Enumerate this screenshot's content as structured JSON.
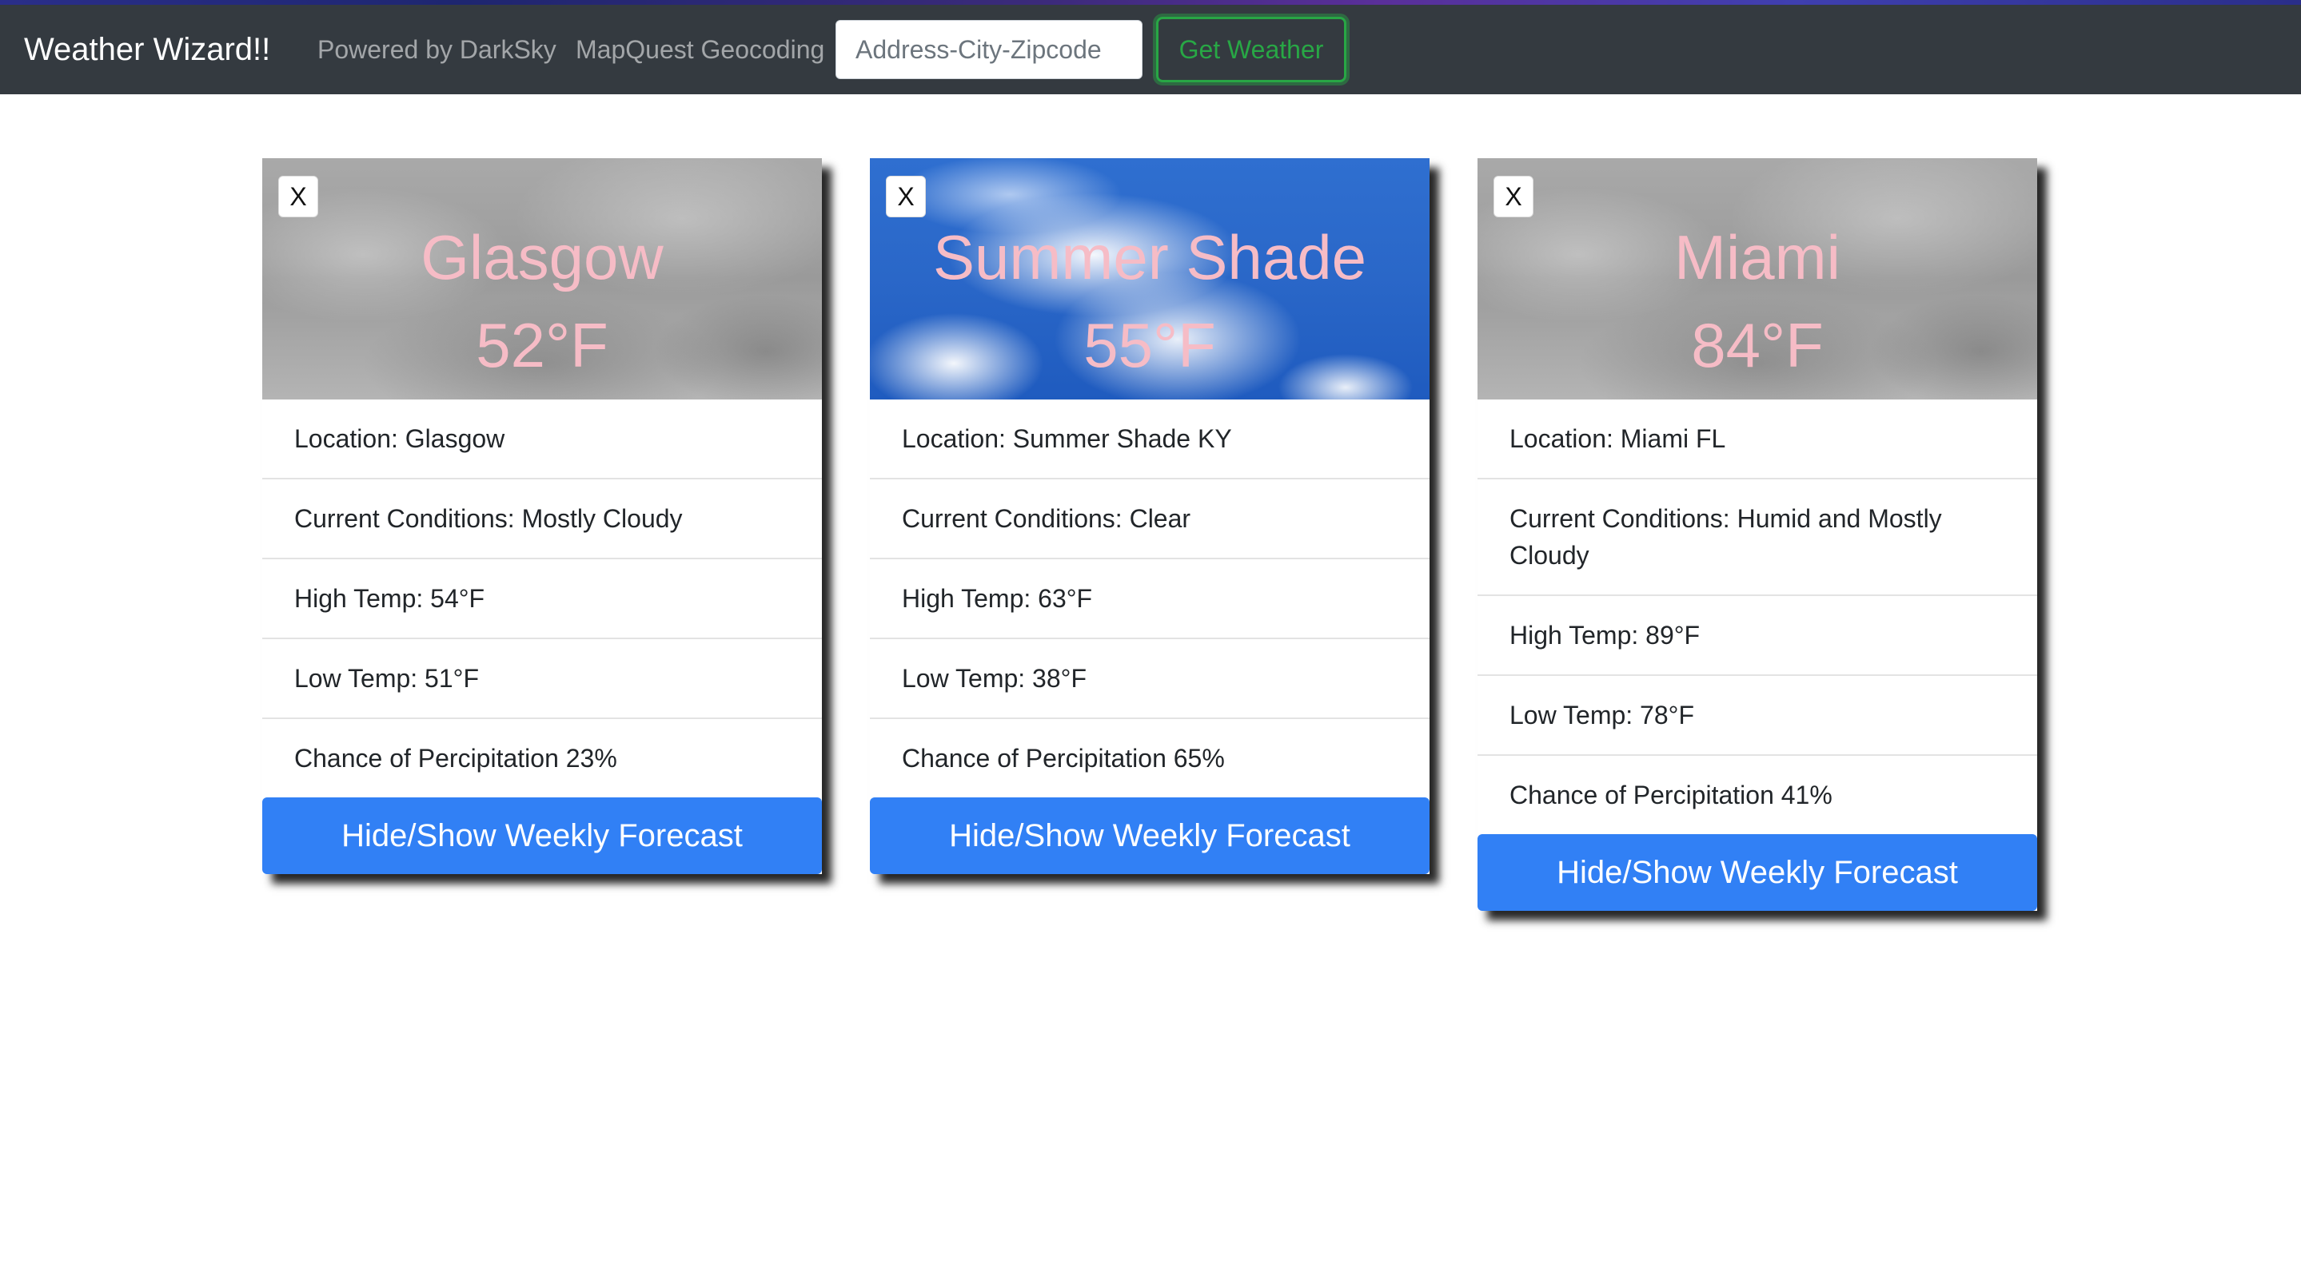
{
  "navbar": {
    "brand": "Weather Wizard!!",
    "links": [
      "Powered by DarkSky",
      "MapQuest Geocoding"
    ],
    "search_placeholder": "Address-City-Zipcode",
    "search_value": "",
    "submit_label": "Get Weather",
    "submit_color": "#28a745"
  },
  "colors": {
    "navbar_bg": "#343a40",
    "primary_button": "#3180f5",
    "header_text": "#f6bcc6"
  },
  "cards": [
    {
      "close_label": "X",
      "city": "Glasgow",
      "temp": "52°F",
      "background": "cloudy",
      "location": "Location: Glasgow",
      "conditions": "Current Conditions: Mostly Cloudy",
      "high": "High Temp: 54°F",
      "low": "Low Temp: 51°F",
      "precip": "Chance of Percipitation 23%",
      "forecast_label": "Hide/Show Weekly Forecast"
    },
    {
      "close_label": "X",
      "city": "Summer Shade",
      "temp": "55°F",
      "background": "clear-sky",
      "location": "Location: Summer Shade KY",
      "conditions": "Current Conditions: Clear",
      "high": "High Temp: 63°F",
      "low": "Low Temp: 38°F",
      "precip": "Chance of Percipitation 65%",
      "forecast_label": "Hide/Show Weekly Forecast"
    },
    {
      "close_label": "X",
      "city": "Miami",
      "temp": "84°F",
      "background": "cloudy",
      "location": "Location: Miami FL",
      "conditions": "Current Conditions: Humid and Mostly Cloudy",
      "high": "High Temp: 89°F",
      "low": "Low Temp: 78°F",
      "precip": "Chance of Percipitation 41%",
      "forecast_label": "Hide/Show Weekly Forecast"
    }
  ]
}
